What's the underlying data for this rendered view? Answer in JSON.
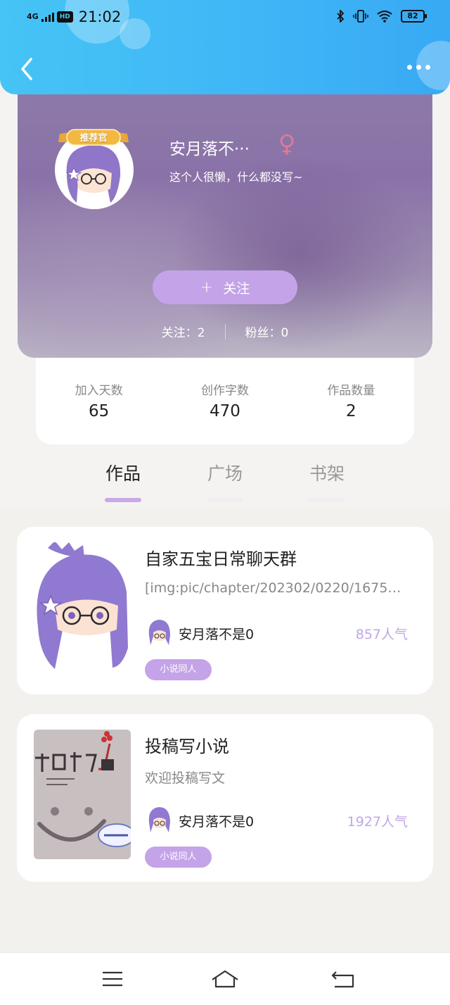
{
  "status_bar": {
    "network": "4G",
    "hd": "HD",
    "time": "21:02",
    "battery": "82"
  },
  "profile": {
    "badge": "推荐官",
    "name": "安月落不···",
    "bio": "这个人很懒，什么都没写~",
    "follow_label": "关注",
    "following": "关注：2",
    "fans": "粉丝：0"
  },
  "stats": [
    {
      "label": "加入天数",
      "value": "65"
    },
    {
      "label": "创作字数",
      "value": "470"
    },
    {
      "label": "作品数量",
      "value": "2"
    }
  ],
  "tabs": [
    "作品",
    "广场",
    "书架"
  ],
  "works": [
    {
      "title": "自家五宝日常聊天群",
      "desc": "[img:pic/chapter/202302/0220/1675…",
      "author": "安月落不是0",
      "popularity": "857人气",
      "tag": "小说同人"
    },
    {
      "title": "投稿写小说",
      "desc": "欢迎投稿写文",
      "author": "安月落不是0",
      "popularity": "1927人气",
      "tag": "小说同人"
    }
  ],
  "colors": {
    "header": "#3fb5f6",
    "accent": "#c4a3e8",
    "popularity": "#c3a6e6"
  }
}
